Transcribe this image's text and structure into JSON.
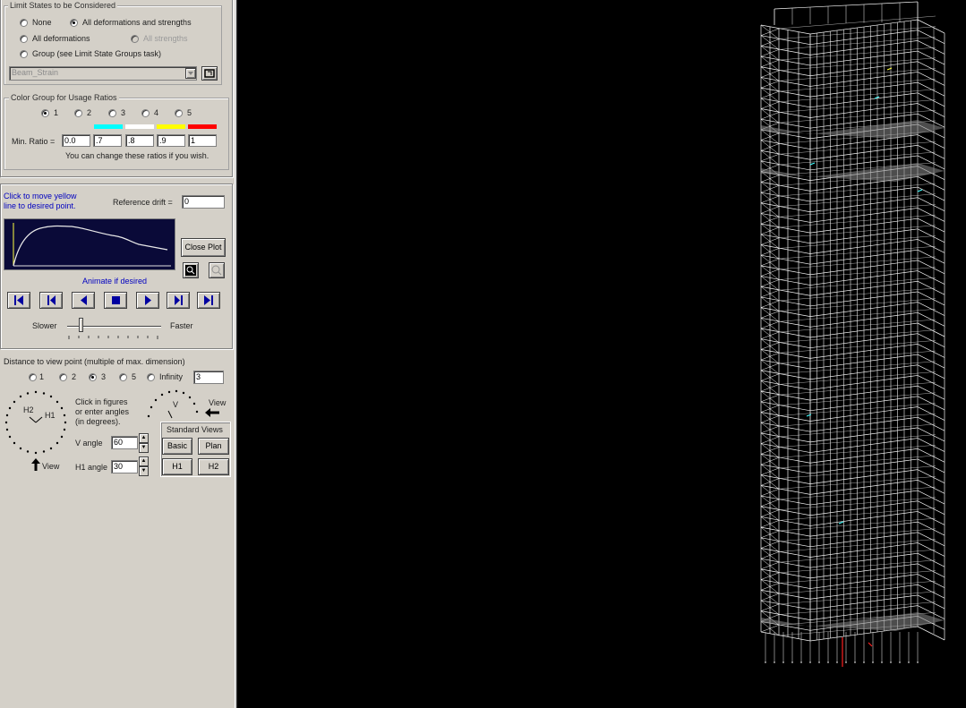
{
  "limit_states": {
    "legend": "Limit States to be Considered",
    "options": [
      "None",
      "All deformations and strengths",
      "All deformations",
      "All strengths",
      "Group (see Limit State Groups task)"
    ],
    "selected": "All deformations and strengths",
    "group_select_value": "Beam_Strain"
  },
  "color_group": {
    "legend": "Color Group for Usage Ratios",
    "options": [
      "1",
      "2",
      "3",
      "4",
      "5"
    ],
    "selected": "1",
    "swatch_colors": [
      "#00ffff",
      "#ffffff",
      "#ffff00",
      "#ff0000"
    ],
    "min_ratio_label": "Min. Ratio =",
    "ratios": [
      "0.0",
      ".7",
      ".8",
      ".9",
      "1"
    ],
    "hint": "You can change these ratios if you wish."
  },
  "plot": {
    "click_hint_line1": "Click to move yellow",
    "click_hint_line2": "line to desired point.",
    "ref_drift_label": "Reference drift =",
    "ref_drift_value": "0",
    "close_plot": "Close Plot",
    "animate_hint": "Animate if desired",
    "slower": "Slower",
    "faster": "Faster"
  },
  "view": {
    "distance_legend": "Distance to view point (multiple of max. dimension)",
    "distance_options": [
      "1",
      "2",
      "3",
      "5",
      "Infinity"
    ],
    "distance_selected": "3",
    "distance_value": "3",
    "h2": "H2",
    "h1": "H1",
    "v": "V",
    "view_label": "View",
    "instructions": [
      "Click in figures",
      "or enter angles",
      "(in degrees)."
    ],
    "v_angle_label": "V angle",
    "v_angle_value": "60",
    "h1_angle_label": "H1 angle",
    "h1_angle_value": "30",
    "standard_views": "Standard Views",
    "basic": "Basic",
    "plan": "Plan",
    "h1_btn": "H1",
    "h2_btn": "H2"
  }
}
